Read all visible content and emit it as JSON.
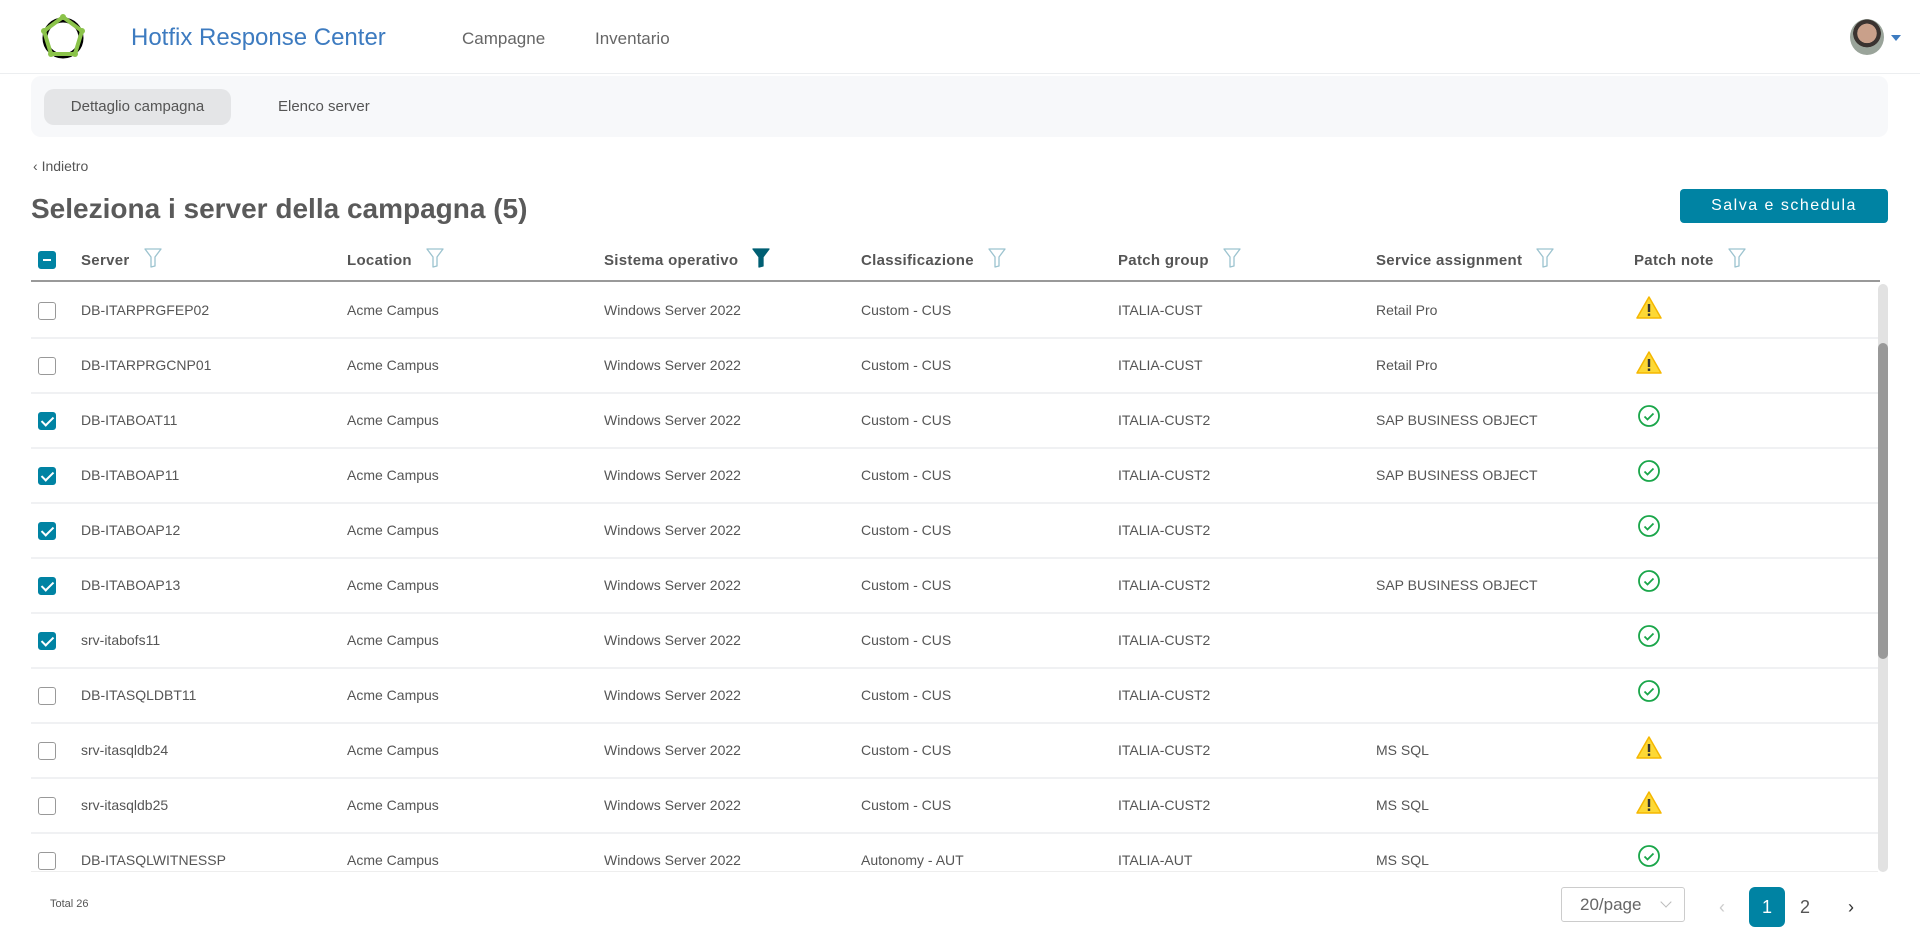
{
  "header": {
    "app_title": "Hotfix Response Center",
    "nav": [
      {
        "label": "Campagne"
      },
      {
        "label": "Inventario"
      }
    ]
  },
  "subnav": {
    "tabs": [
      {
        "label": "Dettaglio campagna",
        "active": true
      },
      {
        "label": "Elenco server",
        "active": false
      }
    ]
  },
  "back_label": "Indietro",
  "page_title": "Seleziona i server della campagna (5)",
  "save_button": "Salva e schedula",
  "colors": {
    "accent": "#0083a3",
    "warning": "#fdd835",
    "ok": "#1aa64a",
    "title": "#3d7bc0"
  },
  "table": {
    "columns": [
      {
        "label": "Server",
        "filter_active": false
      },
      {
        "label": "Location",
        "filter_active": false
      },
      {
        "label": "Sistema operativo",
        "filter_active": true
      },
      {
        "label": "Classificazione",
        "filter_active": false
      },
      {
        "label": "Patch group",
        "filter_active": false
      },
      {
        "label": "Service assignment",
        "filter_active": false
      },
      {
        "label": "Patch note",
        "filter_active": false
      }
    ],
    "select_all": "indeterminate",
    "rows": [
      {
        "checked": false,
        "server": "DB-ITARPRGFEP02",
        "location": "Acme Campus",
        "os": "Windows Server 2022",
        "class": "Custom - CUS",
        "group": "ITALIA-CUST",
        "service": "Retail Pro",
        "note": "warning-icon"
      },
      {
        "checked": false,
        "server": "DB-ITARPRGCNP01",
        "location": "Acme Campus",
        "os": "Windows Server 2022",
        "class": "Custom - CUS",
        "group": "ITALIA-CUST",
        "service": "Retail Pro",
        "note": "warning-icon"
      },
      {
        "checked": true,
        "server": "DB-ITABOAT11",
        "location": "Acme Campus",
        "os": "Windows Server 2022",
        "class": "Custom - CUS",
        "group": "ITALIA-CUST2",
        "service": "SAP BUSINESS OBJECT",
        "note": "check-circle-icon"
      },
      {
        "checked": true,
        "server": "DB-ITABOAP11",
        "location": "Acme Campus",
        "os": "Windows Server 2022",
        "class": "Custom - CUS",
        "group": "ITALIA-CUST2",
        "service": "SAP BUSINESS OBJECT",
        "note": "check-circle-icon"
      },
      {
        "checked": true,
        "server": "DB-ITABOAP12",
        "location": "Acme Campus",
        "os": "Windows Server 2022",
        "class": "Custom - CUS",
        "group": "ITALIA-CUST2",
        "service": "",
        "note": "check-circle-icon"
      },
      {
        "checked": true,
        "server": "DB-ITABOAP13",
        "location": "Acme Campus",
        "os": "Windows Server 2022",
        "class": "Custom - CUS",
        "group": "ITALIA-CUST2",
        "service": "SAP BUSINESS OBJECT",
        "note": "check-circle-icon"
      },
      {
        "checked": true,
        "server": "srv-itabofs11",
        "location": "Acme Campus",
        "os": "Windows Server 2022",
        "class": "Custom - CUS",
        "group": "ITALIA-CUST2",
        "service": "",
        "note": "check-circle-icon"
      },
      {
        "checked": false,
        "server": "DB-ITASQLDBT11",
        "location": "Acme Campus",
        "os": "Windows Server 2022",
        "class": "Custom - CUS",
        "group": "ITALIA-CUST2",
        "service": "",
        "note": "check-circle-icon"
      },
      {
        "checked": false,
        "server": "srv-itasqldb24",
        "location": "Acme Campus",
        "os": "Windows Server 2022",
        "class": "Custom - CUS",
        "group": "ITALIA-CUST2",
        "service": "MS SQL",
        "note": "warning-icon"
      },
      {
        "checked": false,
        "server": "srv-itasqldb25",
        "location": "Acme Campus",
        "os": "Windows Server 2022",
        "class": "Custom - CUS",
        "group": "ITALIA-CUST2",
        "service": "MS SQL",
        "note": "warning-icon"
      },
      {
        "checked": false,
        "server": "DB-ITASQLWITNESSP",
        "location": "Acme Campus",
        "os": "Windows Server 2022",
        "class": "Autonomy - AUT",
        "group": "ITALIA-AUT",
        "service": "MS SQL",
        "note": "check-circle-icon"
      }
    ]
  },
  "footer": {
    "total": "Total 26",
    "page_size": "20/page",
    "pages": [
      "1",
      "2"
    ],
    "current_page": "1"
  }
}
